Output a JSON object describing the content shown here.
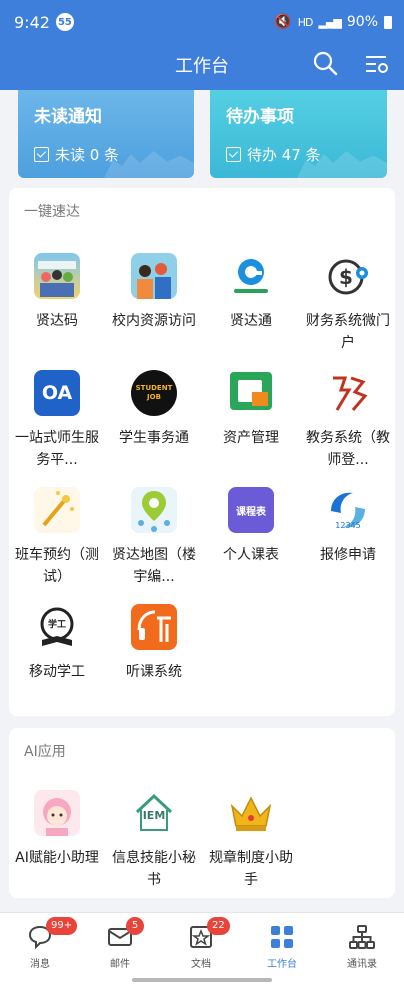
{
  "status": {
    "time": "9:42",
    "notif_badge": "55",
    "icons": "HD",
    "battery": "90%"
  },
  "header": {
    "title": "工作台",
    "search_icon": "search-icon",
    "settings_icon": "settings-icon"
  },
  "banners": [
    {
      "title": "未读通知",
      "sub": "未读 0 条"
    },
    {
      "title": "待办事项",
      "sub": "待办 47 条"
    }
  ],
  "quick": {
    "title": "一键速达",
    "items": [
      {
        "label": "贤达码"
      },
      {
        "label": "校内资源访问"
      },
      {
        "label": "贤达通"
      },
      {
        "label": "财务系统微门户"
      },
      {
        "label": "一站式师生服务平...",
        "icon_text": "OA"
      },
      {
        "label": "学生事务通",
        "icon_text": "STUDENT JOB"
      },
      {
        "label": "资产管理"
      },
      {
        "label": "教务系统（教师登..."
      },
      {
        "label": "班车预约（测试）"
      },
      {
        "label": "贤达地图（楼宇编..."
      },
      {
        "label": "个人课表",
        "icon_text": "课程表"
      },
      {
        "label": "报修申请",
        "icon_text": "12345"
      },
      {
        "label": "移动学工",
        "icon_text": "学工"
      },
      {
        "label": "听课系统"
      }
    ]
  },
  "ai": {
    "title": "AI应用",
    "items": [
      {
        "label": "AI赋能小助理"
      },
      {
        "label": "信息技能小秘书",
        "icon_text": "IEM"
      },
      {
        "label": "规章制度小助手"
      }
    ]
  },
  "nav": [
    {
      "label": "消息",
      "badge": "99+"
    },
    {
      "label": "邮件",
      "badge": "5"
    },
    {
      "label": "文档",
      "badge": "22"
    },
    {
      "label": "工作台",
      "badge": ""
    },
    {
      "label": "通讯录",
      "badge": ""
    }
  ],
  "colors": {
    "primary": "#3f7fdc",
    "badge": "#e8443a"
  }
}
